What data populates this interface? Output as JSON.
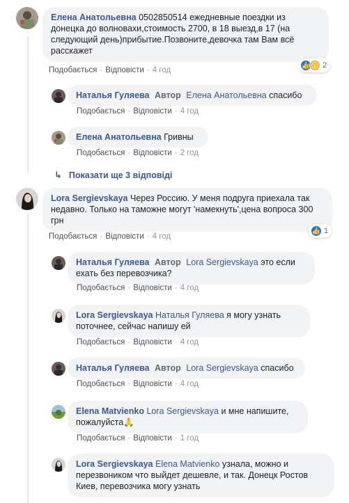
{
  "actions": {
    "like": "Подобається",
    "reply": "Відповісти"
  },
  "badges": {
    "author": "Автор"
  },
  "comments": [
    {
      "author": "Елена Анатольевна",
      "text": "0502850514 ежедневные поездки из донецка до волновахи,стоимость 2700, в 18 выезд,в 17 (на следующий день)прибытие.Позвоните,девочка там Вам всё расскажет",
      "time": "4 год",
      "reactions": {
        "count": "2",
        "types": [
          "like-icon",
          "wow-icon"
        ]
      },
      "replies": [
        {
          "author": "Наталья Гуляева",
          "badge": true,
          "mention": "Елена Анатольевна",
          "text": "спасибо",
          "time": "4 год"
        },
        {
          "author": "Елена Анатольевна",
          "text": "Гривны",
          "time": "2 год"
        }
      ],
      "more_replies": "Показати ще 3 відповіді"
    },
    {
      "author": "Lora Sergievskaya",
      "text": "Через Россию. У меня подруга приехала так недавно. Только на таможне могут 'намекнуть',цена вопроса 300 грн",
      "time": "4 год",
      "reactions": {
        "count": "1",
        "types": [
          "like-icon"
        ]
      },
      "replies": [
        {
          "author": "Наталья Гуляева",
          "badge": true,
          "mention": "Lora Sergievskaya",
          "text": "это если ехать без перевозчика?",
          "time": "4 год"
        },
        {
          "author": "Lora Sergievskaya",
          "mention": "Наталья Гуляева",
          "text": "я могу узнать поточнее, сейчас напишу ей",
          "time": "4 год"
        },
        {
          "author": "Наталья Гуляева",
          "badge": true,
          "mention": "Lora Sergievskaya",
          "text": "спасибо",
          "time": "4 год"
        },
        {
          "author": "Elena Matvienko",
          "mention": "Lora Sergievskaya",
          "text": "и мне напишите, пожалуйста🙏",
          "time": "1 год"
        },
        {
          "author": "Lora Sergievskaya",
          "mention": "Elena Matvienko",
          "text": "узнала, можно и перезвоником что выйдет дешевле, и так. Донецк Ростов Киев, перевозчика могу узнать",
          "time": ""
        }
      ]
    }
  ]
}
